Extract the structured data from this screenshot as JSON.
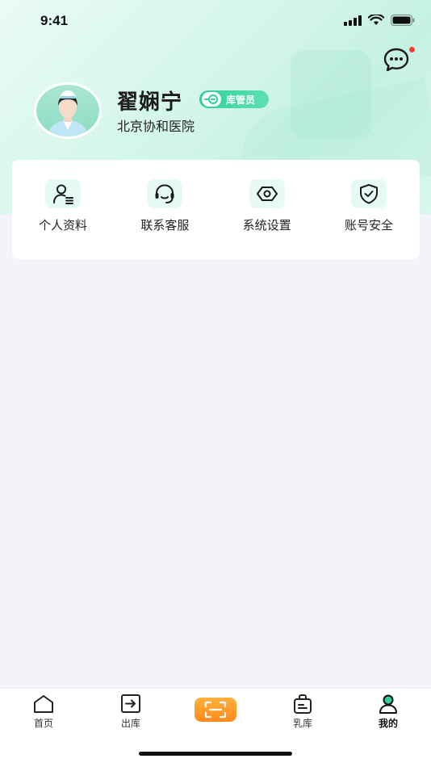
{
  "status_bar": {
    "time": "9:41"
  },
  "profile": {
    "name": "翟娴宁",
    "role": "库管员",
    "hospital": "北京协和医院"
  },
  "menu": [
    {
      "label": "个人资料",
      "icon": "user-profile-icon"
    },
    {
      "label": "联系客服",
      "icon": "headset-icon"
    },
    {
      "label": "系统设置",
      "icon": "settings-hexagon-icon"
    },
    {
      "label": "账号安全",
      "icon": "shield-check-icon"
    }
  ],
  "tabbar": {
    "tabs": [
      {
        "label": "首页",
        "icon": "home-icon"
      },
      {
        "label": "出库",
        "icon": "export-icon"
      },
      {
        "label": "",
        "icon": "scan-icon"
      },
      {
        "label": "乳库",
        "icon": "milk-bank-icon"
      },
      {
        "label": "我的",
        "icon": "user-icon"
      }
    ],
    "active": "我的"
  },
  "colors": {
    "accent": "#2fcf98",
    "scan": "#ff8a1a",
    "notification_dot": "#ff3b30"
  }
}
